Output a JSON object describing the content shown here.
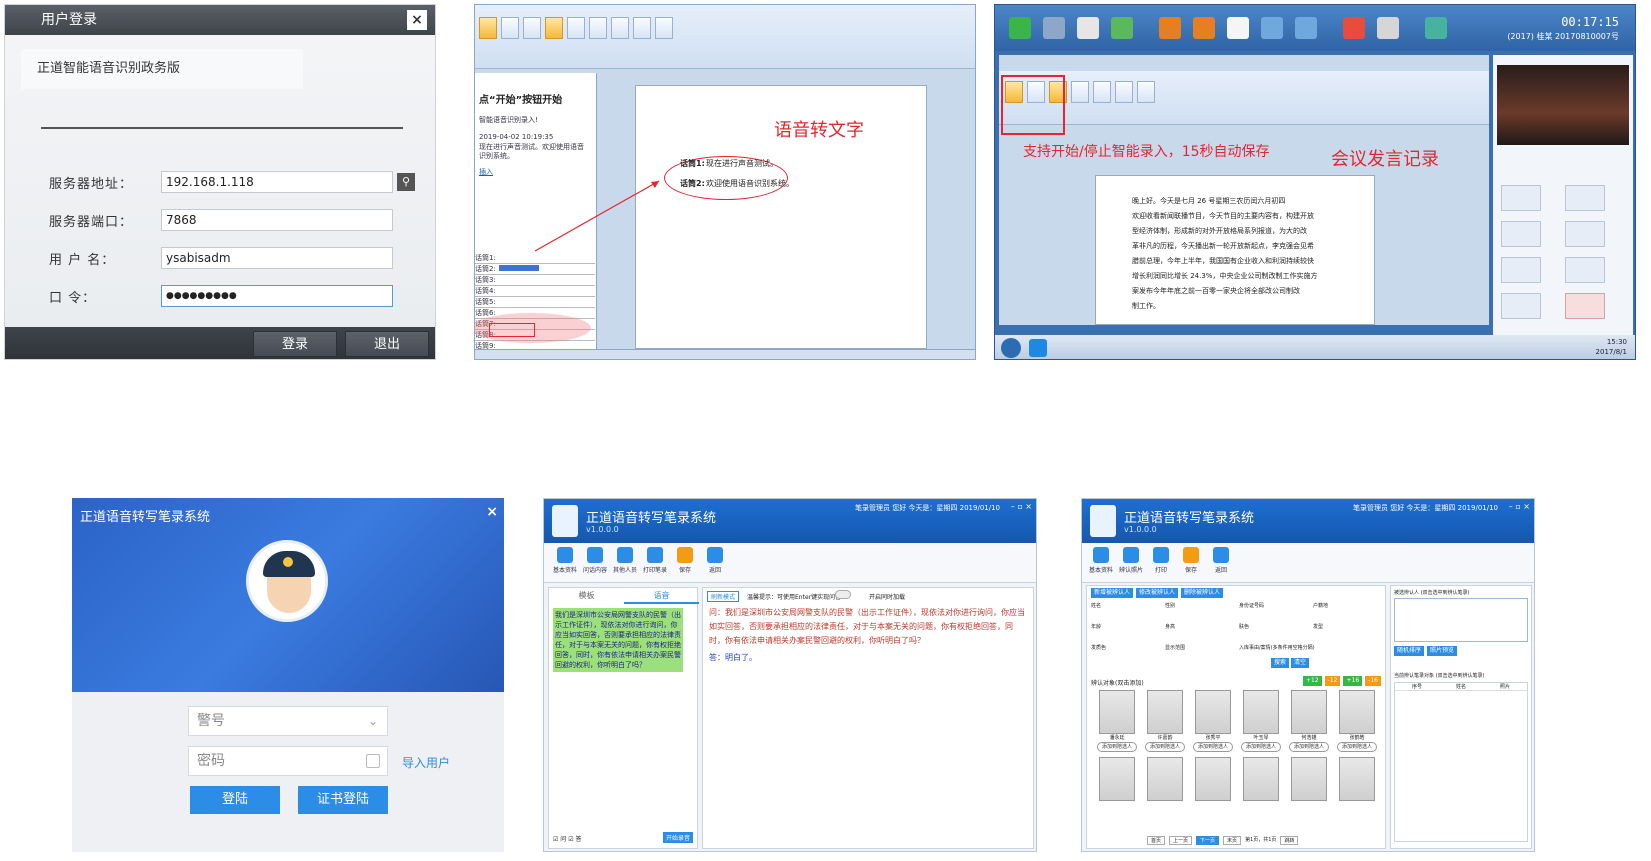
{
  "login_panel": {
    "title": "用户登录",
    "close": "×",
    "subtitle": "正道智能语音识别政务版",
    "fields": [
      {
        "label": "服务器地址：",
        "value": "192.168.1.118"
      },
      {
        "label": "服务器端口：",
        "value": "7868"
      },
      {
        "label": "用  户  名：",
        "value": "ysabisadm"
      },
      {
        "label": "口      令：",
        "value": "●●●●●●●●●"
      }
    ],
    "search_icon": "magnifier-icon",
    "buttons": {
      "login": "登录",
      "exit": "退出"
    }
  },
  "word_panel": {
    "annotation": "语音转文字",
    "task_title": "点“开始”按钮开始",
    "task_line1": "智能语音识别录入!",
    "task_line2": "2019-04-02 10:19:35",
    "task_line3": "现在进行声音测试。欢迎使用语音识别系统。",
    "task_link": "插入",
    "speaker1_label": "话筒1:",
    "speaker1_text": "现在进行声音测试。",
    "speaker2_label": "话筒2:",
    "speaker2_text": "欢迎使用语音识别系统。",
    "channel_rows": [
      "话筒1:",
      "话筒2:",
      "话筒3:",
      "话筒4:",
      "话筒5:",
      "话筒6:",
      "话筒7:",
      "话筒8:",
      "话筒9:"
    ]
  },
  "meeting_panel": {
    "annotation1": "支持开始/停止智能录入，15秒自动保存",
    "annotation2": "会议发言记录",
    "clock": "00:17:15",
    "clock_sub": "(2017) 桂某  20170810007号",
    "doc_lines": [
      "晚上好。今天是七月 26 号星期三农历闰六月初四",
      "欢迎收看新闻联播节目，今天节目的主要内容有，构建开放",
      "型经济体制，形成新的对外开放格局系列报道，为大的改",
      "革非凡的历程，今天播出新一轮开放新起点，李克强会见希",
      "腊前总理，今年上半年，我国国有企业收入和利润持续较快",
      "增长利润同比增长 24.3%，中央企业公司制改制工作实施方",
      "案发布今年年底之前一百零一家央企将全部改公司制改",
      "制工作。"
    ],
    "taskbar_time": "15:30",
    "taskbar_date": "2017/8/1"
  },
  "police_login": {
    "title": "正道语音转写笔录系统",
    "close": "×",
    "badge_placeholder": "警号",
    "password_placeholder": "密码",
    "import_link": "导入用户",
    "btn_login": "登陆",
    "btn_cert": "证书登陆"
  },
  "transcribe_app": {
    "title": "正道语音转写笔录系统",
    "version": "v1.0.0.0",
    "user": "笔录管理员  您好 今天是：星期四  2019/01/10",
    "toolbar": [
      "基本资料",
      "问话内容",
      "其他人员",
      "打印笔录",
      "保存",
      "返回"
    ],
    "tabs": [
      "模板",
      "语音"
    ],
    "switch_btn": "刷新模式",
    "hint": "温馨提示：可使用Enter键实现问答",
    "toggle_label": "开启同时加载",
    "template_text": "我们是深圳市公安局网警支队的民警（出示工作证件），现依法对你进行询问，你应当如实回答，否则要承担相应的法律责任，对于与本案无关的问题，你有权拒绝回答，同时，你有依法申请相关办案民警回避的权利，你听明白了吗？",
    "question": "问：我们是深圳市公安局网警支队的民警（出示工作证件），现依法对你进行询问，你应当如实回答，否则要承担相应的法律责任，对于与本案无关的问题，你有权拒绝回答，同时，你有依法申请相关办案民警回避的权利，你听明白了吗？",
    "answer": "答：明白了。",
    "check1": "问",
    "check2": "答",
    "record_btn": "开始录音"
  },
  "identify_app": {
    "title": "正道语音转写笔录系统",
    "version": "v1.0.0.0",
    "user": "笔录管理员  您好 今天是：星期四  2019/01/10",
    "toolbar": [
      "基本资料",
      "辨认照片",
      "打印",
      "保存",
      "返回"
    ],
    "tabs": [
      "新增被辨认人",
      "修改被辨认人",
      "删除被辨认人"
    ],
    "form_labels": [
      "姓名",
      "性别",
      "身份证号码",
      "户籍地",
      "年龄",
      "身高",
      "肤色",
      "发型",
      "发质色",
      "显示范围",
      "入库事由/案情(多条件用空格分隔)"
    ],
    "search_btn": "搜索",
    "clear_btn": "清空",
    "section_title": "辨认对象(双击添加)",
    "score_chips": [
      "+12",
      "-12",
      "+16",
      "-16"
    ],
    "faces_row1": [
      "潘永廷",
      "许嘉韵",
      "张秀平",
      "叶玉琴",
      "何浩雄",
      "张鹤皓"
    ],
    "face_btn": "添加到陪选人",
    "right_title1": "被选辨认人 (双击选中到辨认笔录)",
    "right_btn1": "随机排序",
    "right_btn2": "照片预览",
    "right_title2": "当前辨认笔录对象 (双击选中到辨认笔录)",
    "right_cols": [
      "序号",
      "姓名",
      "照片"
    ],
    "pager": [
      "首页",
      "上一页",
      "下一页",
      "末页"
    ],
    "pager_info": "第1页，共1页",
    "page_btn": "跳转"
  }
}
